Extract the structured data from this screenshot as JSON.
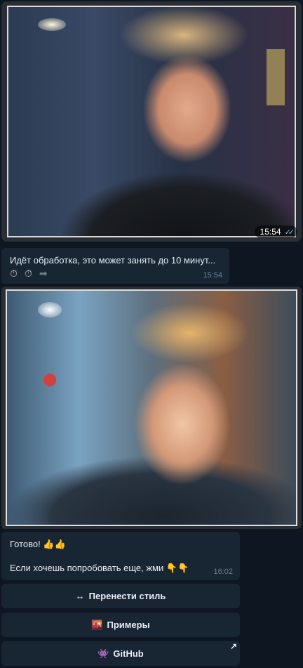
{
  "photo_in": {
    "time": "15:54"
  },
  "processing": {
    "text": "Идёт обработка, это может занять до 10 минут...",
    "icons": [
      "⏱",
      "⏱",
      "➡"
    ],
    "icon_names": [
      "stopwatch-icon",
      "stopwatch-icon",
      "soon-arrow-icon"
    ],
    "time": "15:54"
  },
  "result": {
    "line1": "Готово! 👍👍",
    "line2": "Если хочешь попробовать еще, жми 👇👇",
    "time": "16:02"
  },
  "keyboard": {
    "btn1_emoji": "↔",
    "btn1": "Перенести стиль",
    "btn2_emoji": "🌇",
    "btn2": "Примеры",
    "btn3_emoji": "👾",
    "btn3": "GitHub",
    "btn3_corner": "↗"
  },
  "colors": {
    "bg": "#0e1621",
    "bubble": "#182533",
    "check": "#6ec4ff"
  }
}
